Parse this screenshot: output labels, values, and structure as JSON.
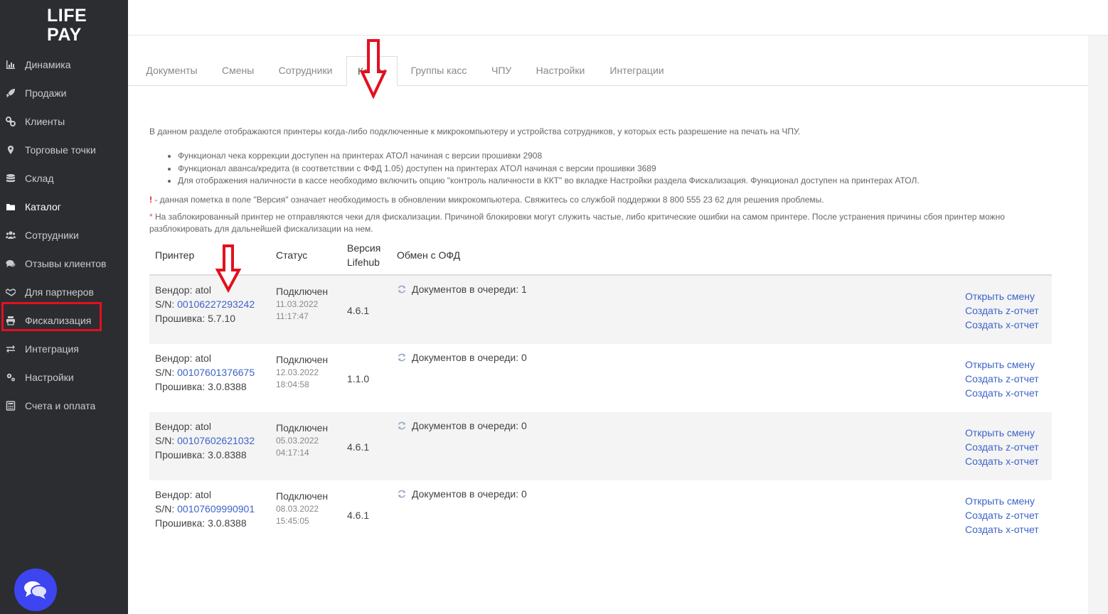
{
  "logo": {
    "line1": "LIFE",
    "line2": "PAY"
  },
  "sidebar": {
    "items": [
      {
        "label": "Динамика",
        "icon": "bar-chart-icon"
      },
      {
        "label": "Продажи",
        "icon": "rocket-icon"
      },
      {
        "label": "Клиенты",
        "icon": "link-icon"
      },
      {
        "label": "Торговые точки",
        "icon": "map-marker-icon"
      },
      {
        "label": "Склад",
        "icon": "database-icon"
      },
      {
        "label": "Каталог",
        "icon": "folder-icon"
      },
      {
        "label": "Сотрудники",
        "icon": "users-icon"
      },
      {
        "label": "Отзывы клиентов",
        "icon": "comments-icon"
      },
      {
        "label": "Для партнеров",
        "icon": "handshake-icon"
      },
      {
        "label": "Фискализация",
        "icon": "printer-icon"
      },
      {
        "label": "Интеграция",
        "icon": "exchange-icon"
      },
      {
        "label": "Настройки",
        "icon": "cogs-icon"
      },
      {
        "label": "Счета и оплата",
        "icon": "calculator-icon"
      }
    ],
    "active": "Каталог",
    "highlighted": "Фискализация"
  },
  "tabs": [
    {
      "label": "Документы"
    },
    {
      "label": "Смены"
    },
    {
      "label": "Сотрудники"
    },
    {
      "label": "Кассы"
    },
    {
      "label": "Группы касс"
    },
    {
      "label": "ЧПУ"
    },
    {
      "label": "Настройки"
    },
    {
      "label": "Интеграции"
    }
  ],
  "active_tab": "Кассы",
  "info": {
    "intro": "В данном разделе отображаются принтеры когда-либо подключенные к микрокомпьютеру и устройства сотрудников, у которых есть разрешение на печать на ЧПУ.",
    "bullets": [
      "Функционал чека коррекции доступен на принтерах АТОЛ начиная с версии прошивки 2908",
      "Функционал аванса/кредита (в соответствии с ФФД 1.05) доступен на принтерах АТОЛ начиная с версии прошивки 3689",
      "Для отображения наличности в кассе необходимо включить опцию \"контроль наличности в ККТ\" во вкладке Настройки раздела Фискализация. Функционал доступен на принтерах АТОЛ."
    ],
    "warning_mark": "!",
    "warning_text": " - данная пометка в поле \"Версия\" означает необходимость в обновлении микрокомпьютера. Свяжитесь со службой поддержки 8 800 555 23 62 для решения проблемы.",
    "blocked_mark": "*",
    "blocked_text_1": " На заблокированный принтер не отправляются чеки для фискализации. Причиной блокировки могут служить частые, либо критические ошибки на самом принтере. После устранения причины сбоя принтер можно",
    "blocked_text_2": "разблокировать для дальнейшей фискализации на нем."
  },
  "table": {
    "headers": {
      "printer": "Принтер",
      "status": "Статус",
      "version_1": "Версия",
      "version_2": "Lifehub",
      "ofd": "Обмен с ОФД"
    },
    "rows": [
      {
        "vendor": "Вендор: atol",
        "sn_label": "S/N: ",
        "sn": "00106227293242",
        "firmware": "Прошивка: 5.7.10",
        "status": "Подключен",
        "date": "11.03.2022",
        "time": "11:17:47",
        "version": "4.6.1",
        "queue": "Документов в очереди: 1"
      },
      {
        "vendor": "Вендор: atol",
        "sn_label": "S/N: ",
        "sn": "00107601376675",
        "firmware": "Прошивка: 3.0.8388",
        "status": "Подключен",
        "date": "12.03.2022",
        "time": "18:04:58",
        "version": "1.1.0",
        "queue": "Документов в очереди: 0"
      },
      {
        "vendor": "Вендор: atol",
        "sn_label": "S/N: ",
        "sn": "00107602621032",
        "firmware": "Прошивка: 3.0.8388",
        "status": "Подключен",
        "date": "05.03.2022",
        "time": "04:17:14",
        "version": "4.6.1",
        "queue": "Документов в очереди: 0"
      },
      {
        "vendor": "Вендор: atol",
        "sn_label": "S/N: ",
        "sn": "00107609990901",
        "firmware": "Прошивка: 3.0.8388",
        "status": "Подключен",
        "date": "08.03.2022",
        "time": "15:45:05",
        "version": "4.6.1",
        "queue": "Документов в очереди: 0"
      }
    ],
    "actions": {
      "open_shift": "Открыть смену",
      "z_report": "Создать z-отчет",
      "x_report": "Создать х-отчет"
    }
  },
  "colors": {
    "sidebar_bg": "#2b2d31",
    "link": "#3d63c9",
    "annotation_red": "#e3101f",
    "chat_button": "#3d45f0"
  }
}
